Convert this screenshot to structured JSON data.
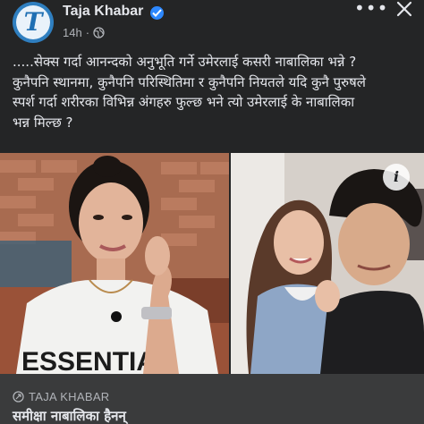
{
  "post": {
    "page_name": "Taja Khabar",
    "time": "14h",
    "separator": "·",
    "more_label": "•••",
    "text_lines": [
      ".....सेक्स गर्दा आनन्दको अनुभूति गर्ने उमेरलाई कसरी नाबालिका भन्ने ?",
      "कुनैपनि स्थानमा, कुनैपनि परिस्थितिमा र कुनैपनि नियतले यदि कुनै पुरुषले",
      "स्पर्श गर्दा शरीरका विभिन्न अंगहरु फुल्छ भने त्यो उमेरलाई के नाबालिका",
      "भन्न मिल्छ ?"
    ]
  },
  "media": {
    "left_shirt_text": "ESSENTIA",
    "info_label": "i"
  },
  "link_card": {
    "domain": "TAJA KHABAR",
    "title": "समीक्षा नाबालिका हैनन्"
  },
  "colors": {
    "background": "#242526",
    "text_primary": "#e4e6eb",
    "text_secondary": "#b0b3b8",
    "verified_badge": "#2d88ff",
    "link_card_bg": "#3a3b3c"
  },
  "icons": [
    "taja-khabar-logo",
    "verified-badge-icon",
    "globe-icon",
    "more-options-icon",
    "close-icon",
    "info-icon",
    "link-icon"
  ]
}
